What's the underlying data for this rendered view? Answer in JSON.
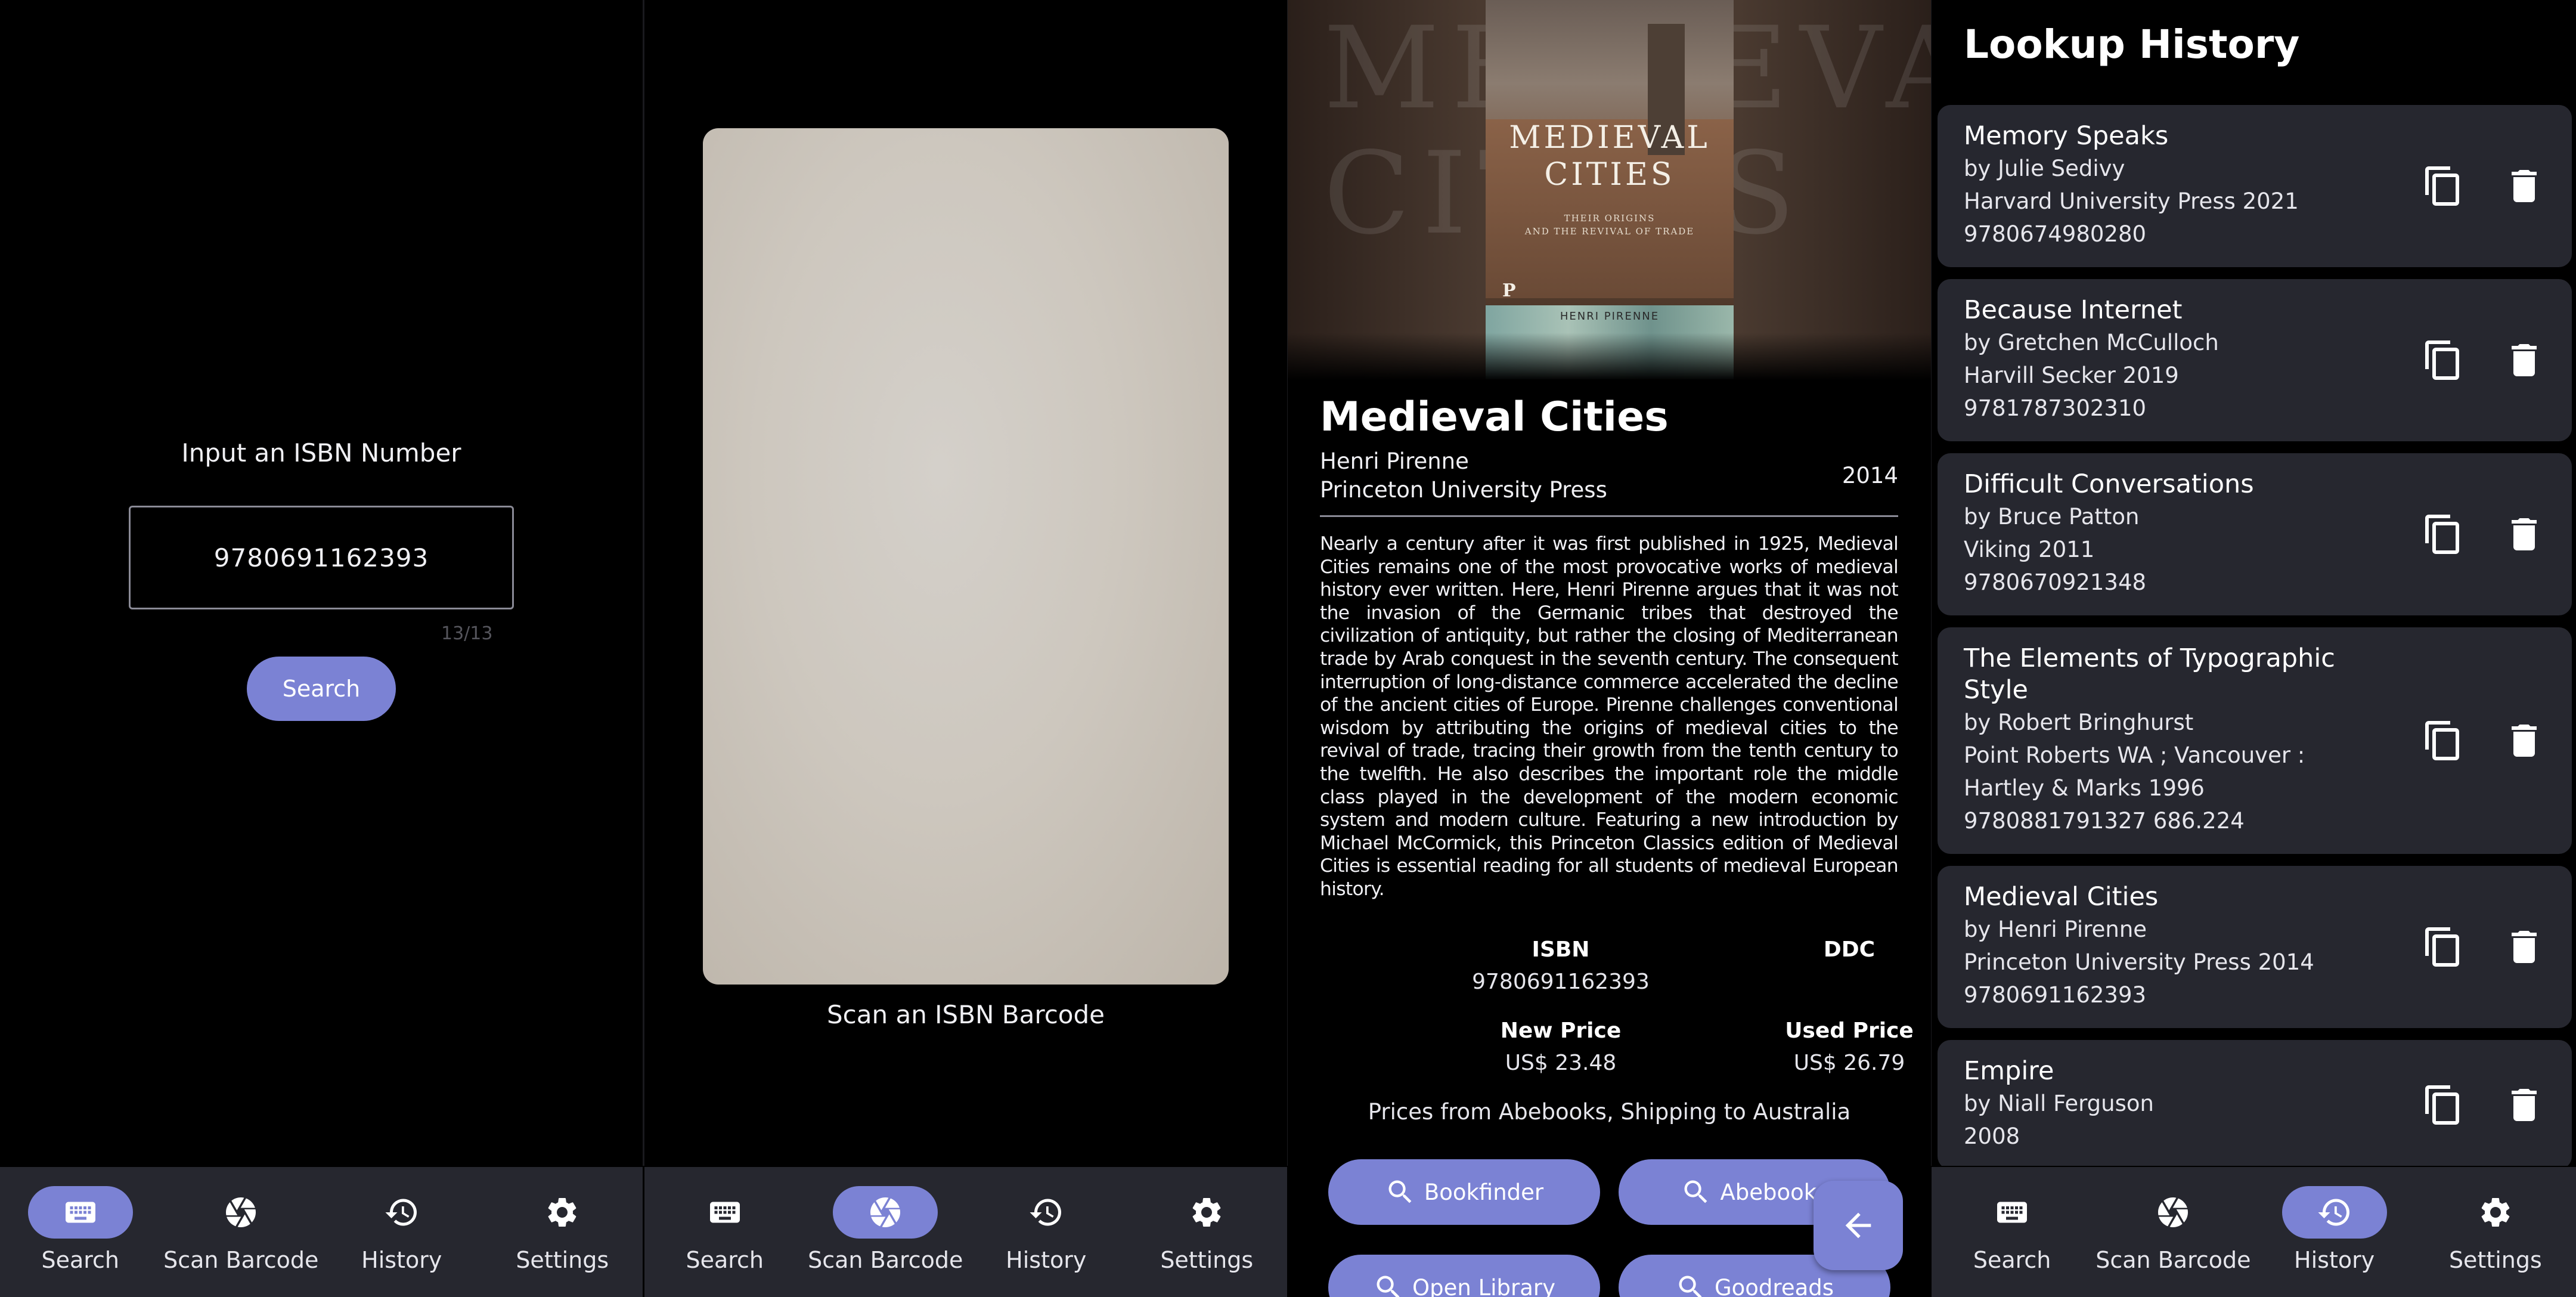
{
  "nav": {
    "items": [
      {
        "label": "Search",
        "icon": "keyboard-icon"
      },
      {
        "label": "Scan Barcode",
        "icon": "aperture-icon"
      },
      {
        "label": "History",
        "icon": "history-icon"
      },
      {
        "label": "Settings",
        "icon": "gear-icon"
      }
    ]
  },
  "search_screen": {
    "title": "Input an ISBN Number",
    "input_value": "9780691162393",
    "counter": "13/13",
    "button_label": "Search",
    "active_nav": "Search"
  },
  "scan_screen": {
    "label": "Scan an ISBN Barcode",
    "active_nav": "Scan Barcode"
  },
  "detail_screen": {
    "cover": {
      "title_line1": "MEDIEVAL",
      "title_line2": "CITIES",
      "subtitle_line1": "THEIR ORIGINS",
      "subtitle_line2": "AND THE REVIVAL OF TRADE",
      "publisher_logo": "P",
      "author": "HENRI PIRENNE"
    },
    "title": "Medieval Cities",
    "author": "Henri Pirenne",
    "publisher": "Princeton University Press",
    "year": "2014",
    "description": "Nearly a century after it was first published in 1925, Medieval Cities remains one of the most provocative works of medieval history ever written. Here, Henri Pirenne argues that it was not the invasion of the Germanic tribes that destroyed the civilization of antiquity, but rather the closing of Mediterranean trade by Arab conquest in the seventh century. The consequent interruption of long-distance commerce accelerated the decline of the ancient cities of Europe. Pirenne challenges conventional wisdom by attributing the origins of medieval cities to the revival of trade, tracing their growth from the tenth century to the twelfth. He also describes the important role the middle class played in the development of the modern economic system and modern culture. Featuring a new introduction by Michael McCormick, this Princeton Classics edition of Medieval Cities is essential reading for all students of medieval European history.",
    "isbn_label": "ISBN",
    "isbn_value": "9780691162393",
    "ddc_label": "DDC",
    "ddc_value": "",
    "new_price_label": "New Price",
    "new_price_value": "US$ 23.48",
    "used_price_label": "Used Price",
    "used_price_value": "US$ 26.79",
    "prices_note": "Prices from Abebooks, Shipping to Australia",
    "links": [
      "Bookfinder",
      "Abebooks",
      "Open Library",
      "Goodreads"
    ]
  },
  "history_screen": {
    "title": "Lookup History",
    "active_nav": "History",
    "entries": [
      {
        "title": "Memory Speaks",
        "lines": [
          "by Julie Sedivy",
          "Harvard University Press 2021",
          "9780674980280"
        ]
      },
      {
        "title": "Because Internet",
        "lines": [
          "by Gretchen McCulloch",
          "Harvill Secker 2019",
          "9781787302310"
        ]
      },
      {
        "title": "Difficult Conversations",
        "lines": [
          "by Bruce Patton",
          "Viking 2011",
          "9780670921348"
        ]
      },
      {
        "title": "The Elements of Typographic Style",
        "lines": [
          "by Robert Bringhurst",
          "Point Roberts WA ; Vancouver : Hartley & Marks 1996",
          "9780881791327 686.224"
        ]
      },
      {
        "title": "Medieval Cities",
        "lines": [
          "by Henri Pirenne",
          "Princeton University Press 2014",
          "9780691162393"
        ]
      },
      {
        "title": "Empire",
        "lines": [
          "by Niall Ferguson",
          "2008"
        ]
      }
    ]
  },
  "colors": {
    "accent": "#7b82d4",
    "surface": "#26272f",
    "background": "#000000"
  }
}
